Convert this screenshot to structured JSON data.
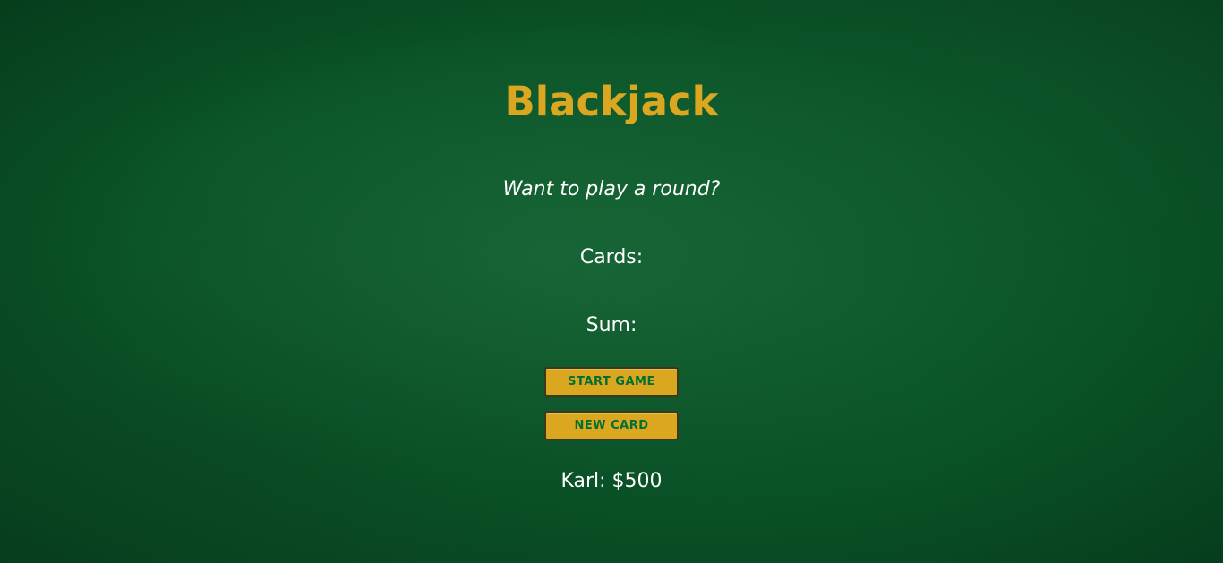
{
  "title": "Blackjack",
  "message": "Want to play a round?",
  "cards_label": "Cards:",
  "sum_label": "Sum:",
  "buttons": {
    "start_game": "START GAME",
    "new_card": "NEW CARD"
  },
  "player": "Karl: $500",
  "colors": {
    "background": "#0a5428",
    "accent": "#dba720",
    "button_text": "#016f32",
    "text": "#ffffff"
  }
}
